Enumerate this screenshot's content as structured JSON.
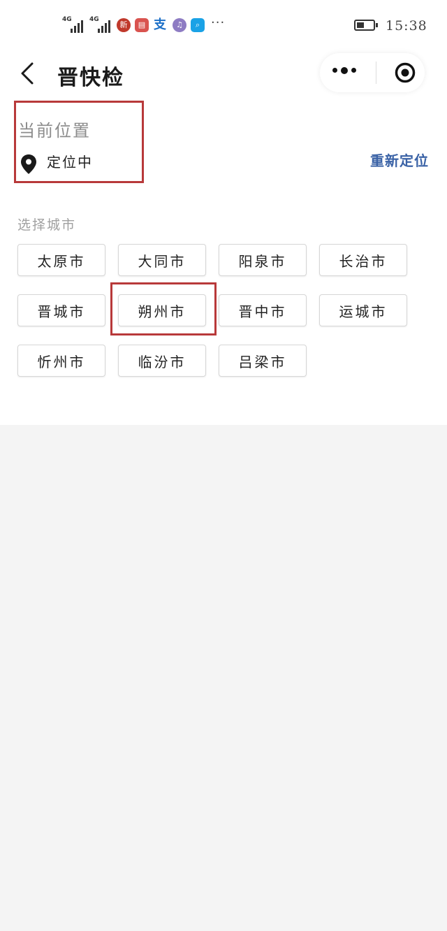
{
  "status_bar": {
    "network_1": "4G",
    "network_2": "4G",
    "clock": "15:38",
    "app_icons": [
      "news-app-icon",
      "reader-app-icon",
      "alipay-icon",
      "music-app-icon",
      "search-app-icon"
    ],
    "more": "···"
  },
  "nav": {
    "title": "晋快检"
  },
  "location": {
    "label": "当前位置",
    "status": "定位中",
    "relocate": "重新定位"
  },
  "cities": {
    "section_label": "选择城市",
    "items": [
      "太原市",
      "大同市",
      "阳泉市",
      "长治市",
      "晋城市",
      "朔州市",
      "晋中市",
      "运城市",
      "忻州市",
      "临汾市",
      "吕梁市"
    ],
    "highlighted": "朔州市"
  },
  "colors": {
    "accent_link": "#3a62a6",
    "highlight_border": "#b8393a",
    "background": "#f4f4f4"
  }
}
